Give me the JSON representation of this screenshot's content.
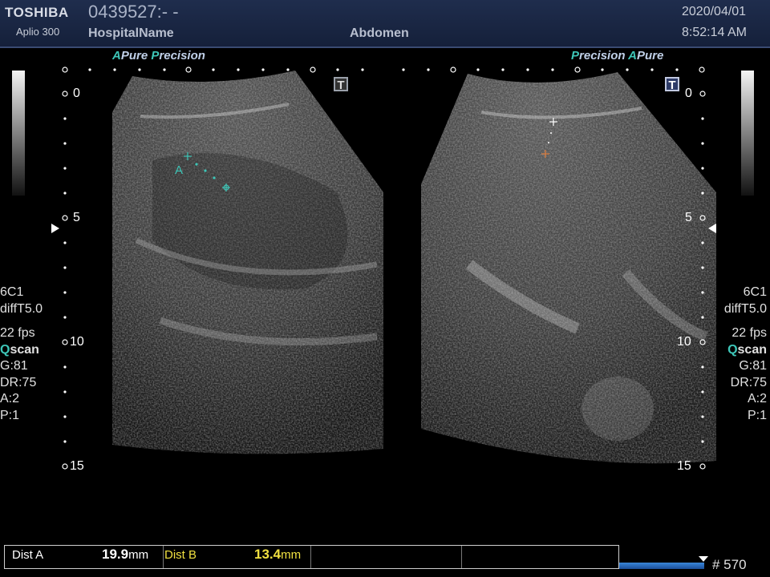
{
  "header": {
    "brand": "TOSHIBA",
    "model": "Aplio 300",
    "patient_id": "0439527:- -",
    "hospital": "HospitalName",
    "exam": "Abdomen",
    "date": "2020/04/01",
    "time": "8:52:14 AM"
  },
  "left_pane": {
    "mode_a": "A",
    "mode_pure": "Pure",
    "mode_p": "P",
    "mode_precision": "recision",
    "depths": [
      "0",
      "5",
      "10",
      "15"
    ],
    "marker_label": "A"
  },
  "right_pane": {
    "mode_p": "P",
    "mode_precision": "recision",
    "mode_a": "A",
    "mode_pure": "Pure",
    "depths": [
      "0",
      "5",
      "10",
      "15"
    ]
  },
  "tmark": "T",
  "settings_left": {
    "probe": "6C1",
    "preset": "diffT5.0",
    "fps": "22 fps",
    "qscan_q": "Q",
    "qscan_rest": "scan",
    "gain": "G:81",
    "dr": "DR:75",
    "a": "A:2",
    "p": "P:1"
  },
  "settings_right": {
    "probe": "6C1",
    "preset": "diffT5.0",
    "fps": "22 fps",
    "qscan_q": "Q",
    "qscan_rest": "scan",
    "gain": "G:81",
    "dr": "DR:75",
    "a": "A:2",
    "p": "P:1"
  },
  "measurements": {
    "dist_a_label": "Dist A",
    "dist_a_value": "19.9",
    "dist_a_unit": "mm",
    "dist_b_label": "Dist B",
    "dist_b_value": "13.4",
    "dist_b_unit": "mm"
  },
  "frame": {
    "progress_fraction": 1.0,
    "count": "# 570"
  },
  "colors": {
    "header_bg": "#1f2d4d",
    "teal": "#3ec6b8",
    "dist_a_value": "#ffffff",
    "dist_b": "#f0e040",
    "frame_bar": "#3a86d8"
  }
}
